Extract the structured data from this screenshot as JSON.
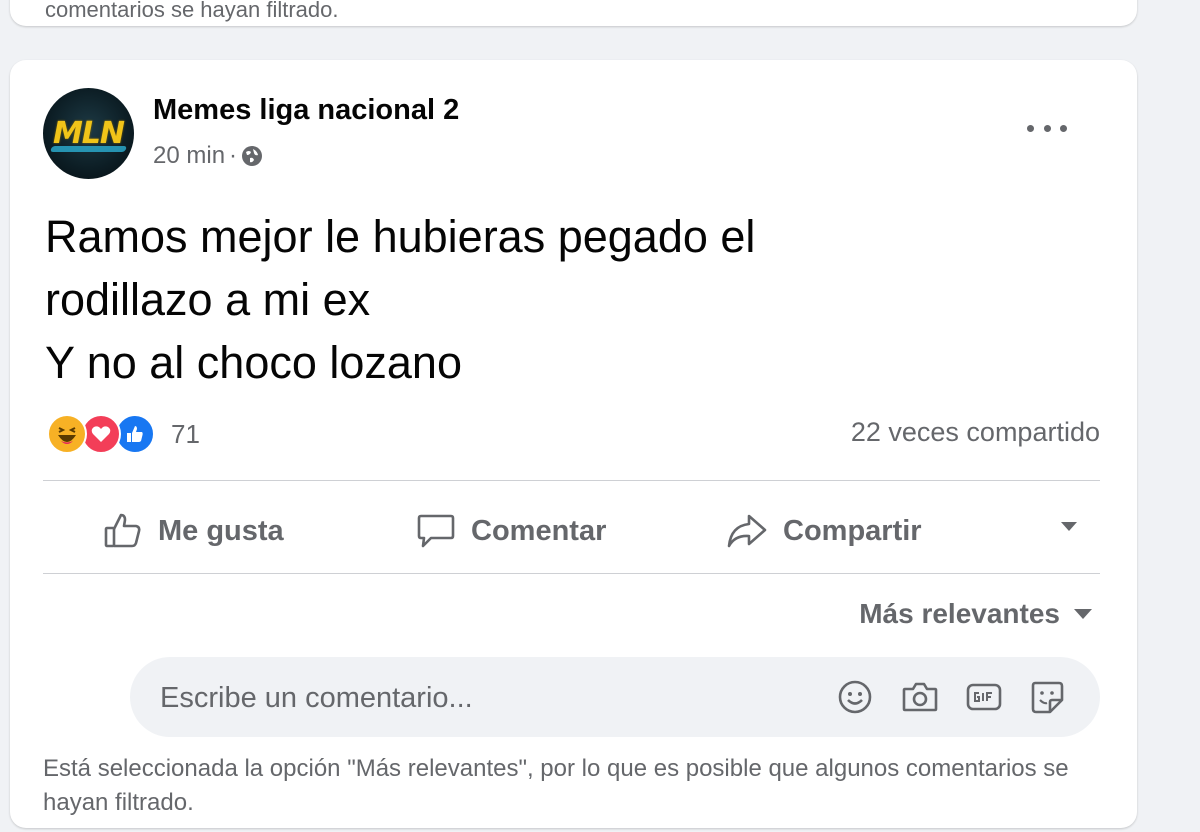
{
  "previous_post": {
    "footer_text": "comentarios se hayan filtrado."
  },
  "post": {
    "page_name": "Memes liga nacional 2",
    "timestamp": "20 min",
    "separator": "·",
    "avatar_text": "MLN",
    "text_lines": [
      "Ramos mejor le hubieras pegado el",
      "rodillazo a mi ex",
      "Y no al choco lozano"
    ],
    "reactions": {
      "types": [
        "haha",
        "love",
        "like"
      ],
      "count": "71"
    },
    "shares": "22 veces compartido",
    "actions": {
      "like": "Me gusta",
      "comment": "Comentar",
      "share": "Compartir"
    },
    "sort_label": "Más relevantes",
    "comment_placeholder": "Escribe un comentario...",
    "filter_note": "Está seleccionada la opción \"Más relevantes\", por lo que es posible que algunos comentarios se hayan filtrado."
  },
  "colors": {
    "background": "#f0f2f5",
    "card": "#ffffff",
    "secondary_text": "#65676b",
    "like_blue": "#1877f2",
    "love_red": "#f33e58",
    "haha_yellow": "#f7b125"
  }
}
